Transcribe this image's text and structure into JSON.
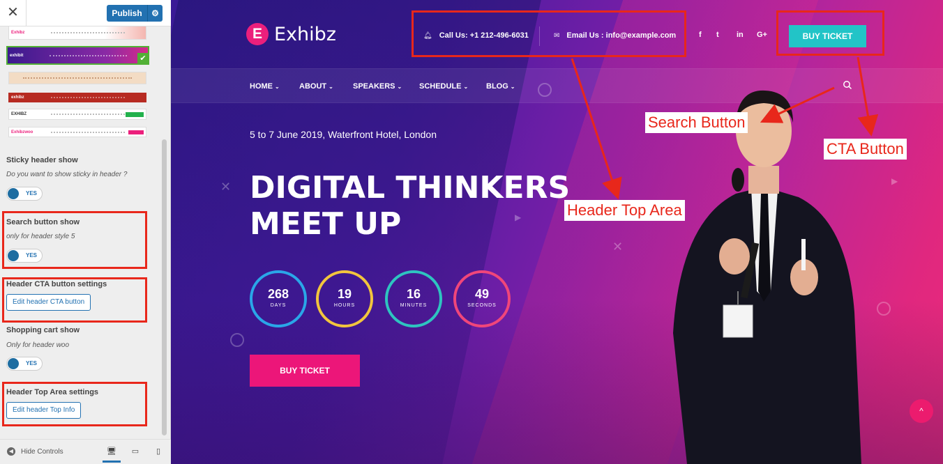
{
  "sidebar": {
    "close_icon": "close-icon",
    "publish_label": "Publish",
    "header_styles": [
      {
        "logo": "Exhibz",
        "accent": "#f4b6b0"
      },
      {
        "logo": "exhibit",
        "accent": "#4b1ba0",
        "selected": true
      },
      {
        "logo": "",
        "accent": "#f3dcc4"
      },
      {
        "logo": "exhibz",
        "accent": "#b72b22"
      },
      {
        "logo": "EXHIBZ",
        "accent": "#22b14c"
      },
      {
        "logo": "Exhibzwoo",
        "accent": "#ec1f7c"
      }
    ],
    "sticky": {
      "title": "Sticky header show",
      "desc": "Do you want to show sticky in header ?",
      "toggle": "YES"
    },
    "search": {
      "title": "Search button show",
      "desc": "only for header style 5",
      "toggle": "YES"
    },
    "cta": {
      "title": "Header CTA button settings",
      "button": "Edit header CTA button"
    },
    "cart": {
      "title": "Shopping cart show",
      "desc": "Only for header woo",
      "toggle": "YES"
    },
    "top_area": {
      "title": "Header Top Area settings",
      "button": "Edit header Top Info"
    },
    "footer": {
      "hide_controls": "Hide Controls"
    }
  },
  "preview": {
    "logo_text": "Exhibz",
    "logo_letter": "E",
    "call": "Call Us: +1 212-496-6031",
    "email": "Email Us : info@example.com",
    "social": [
      "f",
      "t",
      "in",
      "G+"
    ],
    "buy_ticket_top": "BUY TICKET",
    "nav": [
      "HOME",
      "ABOUT",
      "SPEAKERS",
      "SCHEDULE",
      "BLOG"
    ],
    "date_line": "5 to 7 June 2019, Waterfront Hotel, London",
    "title_line1": "DIGITAL THINKERS",
    "title_line2": "MEET UP",
    "countdown": [
      {
        "value": "268",
        "unit": "DAYS",
        "color": "#2aa6e8"
      },
      {
        "value": "19",
        "unit": "HOURS",
        "color": "#f2c53d"
      },
      {
        "value": "16",
        "unit": "MINUTES",
        "color": "#2ec4c0"
      },
      {
        "value": "49",
        "unit": "SECONDS",
        "color": "#f0467a"
      }
    ],
    "buy_ticket_main": "BUY TICKET",
    "scroll_top": "^"
  },
  "annotations": {
    "search_button": "Search Button",
    "cta_button": "CTA Button",
    "header_top_area": "Header Top Area"
  },
  "colors": {
    "annotation_red": "#e8271b",
    "cta_teal": "#22c4c7",
    "brand_pink": "#ec1679",
    "wp_blue": "#2271b1"
  }
}
